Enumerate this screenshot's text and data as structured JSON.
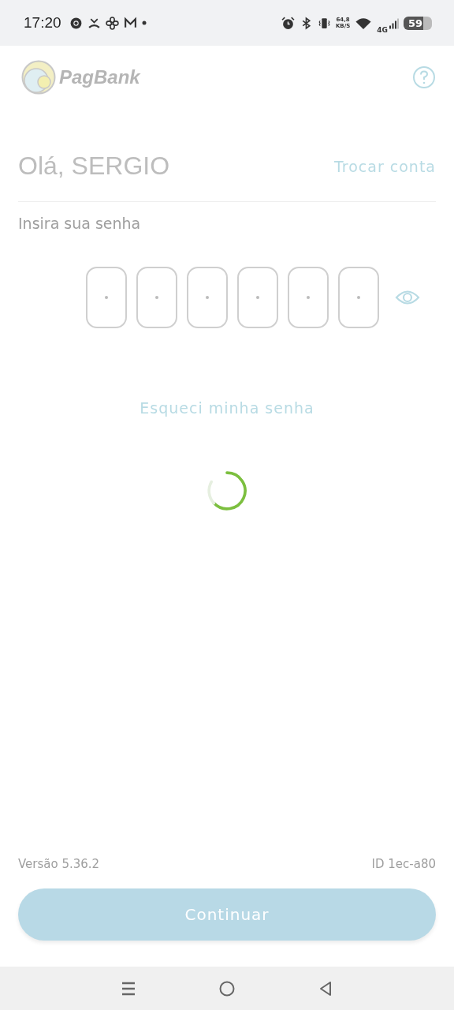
{
  "status_bar": {
    "time": "17:20",
    "net_speed": "64,8",
    "net_unit": "KB/S",
    "network": "4G",
    "battery": "59"
  },
  "header": {
    "logo_text": "PagBank"
  },
  "greeting": {
    "text": "Olá, SERGIO",
    "switch_account": "Trocar conta"
  },
  "password": {
    "label": "Insira sua senha",
    "boxes": [
      {
        "filled": false
      },
      {
        "filled": false
      },
      {
        "filled": false
      },
      {
        "filled": false
      },
      {
        "filled": false
      },
      {
        "filled": false
      }
    ]
  },
  "forgot_password": "Esqueci minha senha",
  "loading": true,
  "footer": {
    "version": "Versão 5.36.2",
    "id": "ID 1ec-a80"
  },
  "continue_button": {
    "label": "Continuar",
    "disabled": true
  }
}
